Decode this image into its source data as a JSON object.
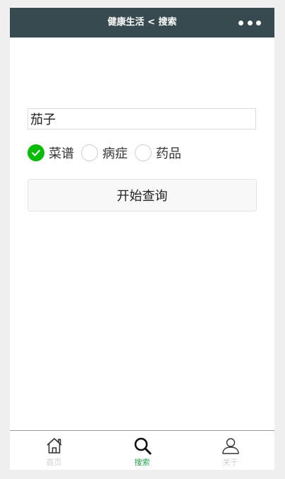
{
  "navbar": {
    "title": "健康生活 < 搜索",
    "more_icon": "more-dots-icon"
  },
  "search": {
    "value": "茄子"
  },
  "category": {
    "options": [
      {
        "label": "菜谱",
        "checked": true
      },
      {
        "label": "病症",
        "checked": false
      },
      {
        "label": "药品",
        "checked": false
      }
    ]
  },
  "query_button": {
    "label": "开始查询"
  },
  "tabbar": {
    "tabs": [
      {
        "label": "首页",
        "icon": "home-icon",
        "active": false
      },
      {
        "label": "搜索",
        "icon": "search-icon",
        "active": true
      },
      {
        "label": "关于",
        "icon": "user-icon",
        "active": false
      }
    ]
  },
  "colors": {
    "navbar_bg": "#374a4f",
    "radio_checked": "#09bb07",
    "tab_active": "#23a14a",
    "tab_inactive": "#d0d0d0"
  }
}
